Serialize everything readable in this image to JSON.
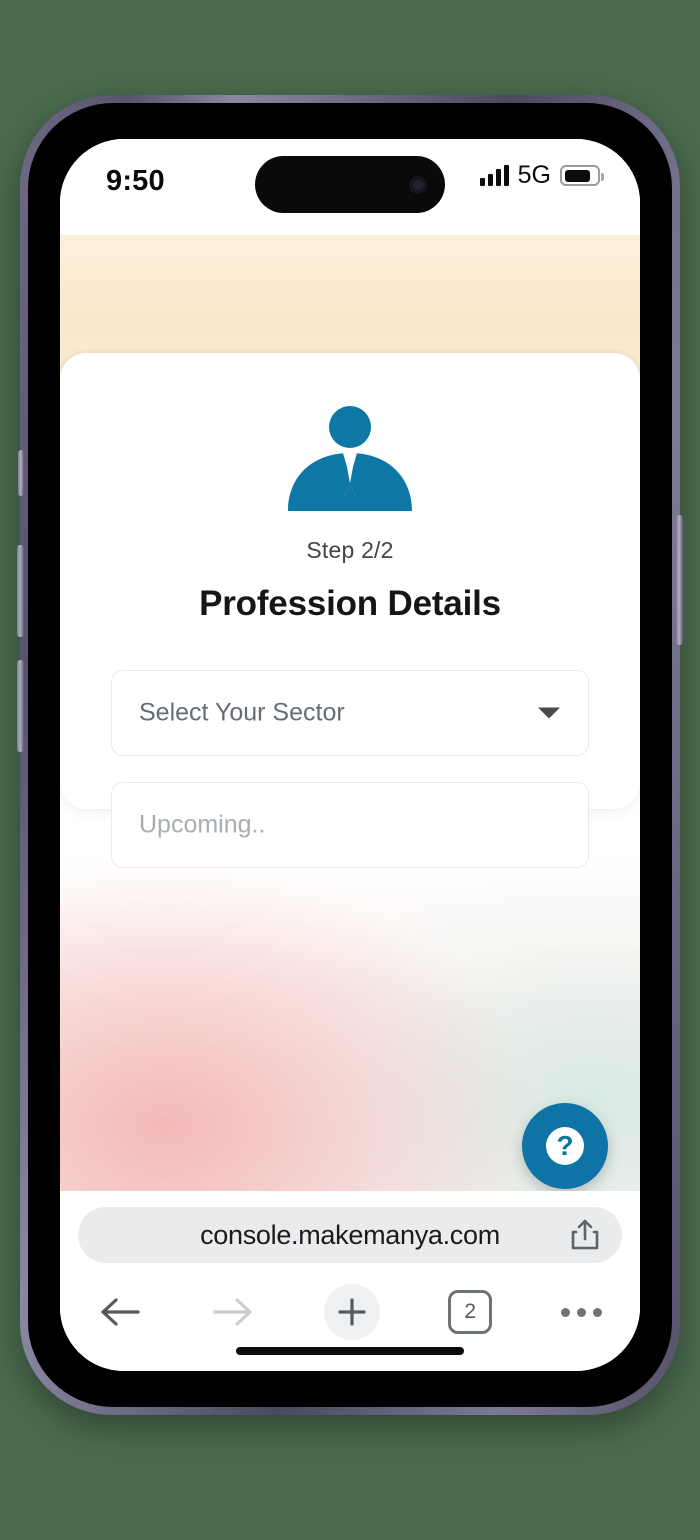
{
  "background_color": "#4a6b4e",
  "status_bar": {
    "time": "9:50",
    "network": "5G",
    "signal_icon": "signal-bars-icon",
    "battery_icon": "battery-icon",
    "battery_level_percent": 72
  },
  "card": {
    "icon": "businessman-icon",
    "icon_color": "#0d78a5",
    "step_label": "Step 2/2",
    "title": "Profession Details",
    "fields": [
      {
        "name": "sector-select",
        "placeholder": "Select Your Sector",
        "value": "",
        "type": "select",
        "icon": "chevron-down-icon"
      },
      {
        "name": "upcoming-input",
        "placeholder": "Upcoming..",
        "value": "",
        "type": "text",
        "disabled": true
      }
    ]
  },
  "help_button": {
    "icon": "question-mark-icon",
    "label": "?",
    "color": "#0d74a5"
  },
  "browser": {
    "url": "console.makemanya.com",
    "share_icon": "share-icon",
    "toolbar": {
      "back_icon": "arrow-left-icon",
      "forward_icon": "arrow-right-icon",
      "new_tab_icon": "plus-icon",
      "tab_count": "2",
      "more_icon": "ellipsis-icon"
    }
  },
  "device": {
    "home_indicator": "home-indicator",
    "buttons": [
      "silent-switch",
      "volume-up-button",
      "volume-down-button",
      "power-button"
    ]
  }
}
